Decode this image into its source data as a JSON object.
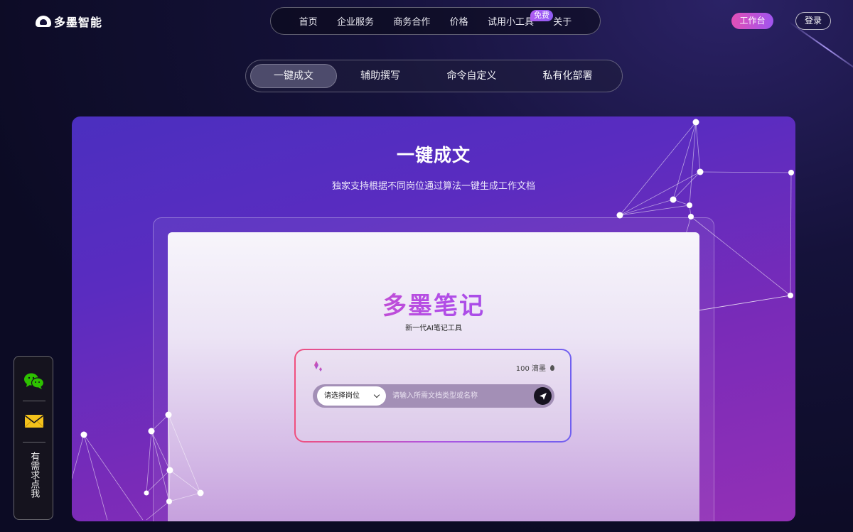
{
  "header": {
    "logo_text": "多墨智能",
    "nav": [
      "首页",
      "企业服务",
      "商务合作",
      "价格",
      "试用小工具",
      "关于"
    ],
    "free_badge": "免费",
    "workbench_label": "工作台",
    "login_label": "登录"
  },
  "feature_tabs": {
    "items": [
      "一键成文",
      "辅助撰写",
      "命令自定义",
      "私有化部署"
    ],
    "active": "一键成文"
  },
  "hero": {
    "title": "一键成文",
    "subtitle": "独家支持根据不同岗位通过算法一键生成工作文档"
  },
  "mockup": {
    "brand": "多墨笔记",
    "tagline": "新一代AI笔记工具",
    "credits": "100 滴墨",
    "select_value": "请选择岗位",
    "input_placeholder": "请输入所需文档类型或名称"
  },
  "side_panel": {
    "contact_text": "有需求点我",
    "icons": [
      "wechat-icon",
      "mail-icon"
    ]
  },
  "colors": {
    "accent_pink": "#e24fb6",
    "accent_purple": "#a055f0",
    "background": "#0c0b24"
  }
}
